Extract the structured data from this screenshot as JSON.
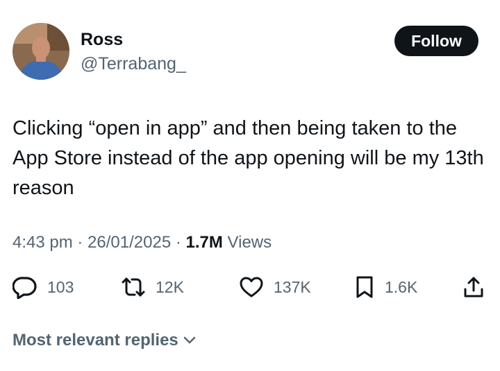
{
  "author": {
    "name": "Ross",
    "handle": "@Terrabang_"
  },
  "follow_label": "Follow",
  "tweet": {
    "text": "Clicking “open in app” and then being taken to the App Store instead of the app opening will be my 13th reason"
  },
  "meta": {
    "time": "4:43 pm",
    "date": "26/01/2025",
    "views_count": "1.7M",
    "views_label": "Views"
  },
  "actions": {
    "replies": {
      "icon": "reply-icon",
      "count": "103"
    },
    "reposts": {
      "icon": "repost-icon",
      "count": "12K"
    },
    "likes": {
      "icon": "heart-icon",
      "count": "137K"
    },
    "bookmarks": {
      "icon": "bookmark-icon",
      "count": "1.6K"
    },
    "share": {
      "icon": "share-icon"
    }
  },
  "replies_sort_label": "Most relevant replies",
  "colors": {
    "text": "#0f1419",
    "secondary": "#536471",
    "follow_bg": "#0f1419"
  }
}
